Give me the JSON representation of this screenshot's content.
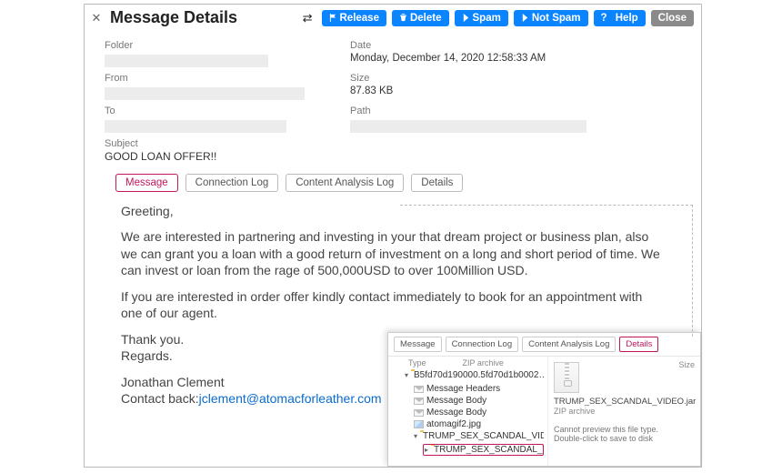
{
  "titlebar": {
    "title": "Message Details",
    "buttons": {
      "release": "Release",
      "delete": "Delete",
      "spam": "Spam",
      "not_spam": "Not Spam",
      "help": "Help",
      "close": "Close"
    }
  },
  "fields": {
    "folder_label": "Folder",
    "from_label": "From",
    "to_label": "To",
    "date_label": "Date",
    "date_value": "Monday, December 14, 2020 12:58:33 AM",
    "size_label": "Size",
    "size_value": "87.83 KB",
    "path_label": "Path",
    "subject_label": "Subject",
    "subject_value": "GOOD LOAN OFFER!!"
  },
  "tabs": {
    "message": "Message",
    "connlog": "Connection Log",
    "calog": "Content Analysis Log",
    "details": "Details"
  },
  "body": {
    "p1": "Greeting,",
    "p2": "We are interested in partnering and investing in your that dream project or business plan, also we can grant you a loan with a good return of investment on a long and short period of time. We can invest or loan from the rage of 500,000USD to over 100Million USD.",
    "p3": "If you are interested in order offer kindly contact immediately to book for an appointment with one of our agent.",
    "p4": "Thank you.",
    "p5": "Regards.",
    "p6": "Jonathan Clement",
    "p7a": "Contact back:",
    "p7b": "jclement@atomacforleather.com"
  },
  "inset": {
    "tabs": {
      "message": "Message",
      "connlog": "Connection Log",
      "calog": "Content Analysis Log",
      "details": "Details"
    },
    "tree_header_type": "Type",
    "tree_header_col2": "ZIP archive",
    "tree_header_col3": "Size",
    "items": {
      "root": "B5fd70d190000.5fd70d1b0002…",
      "mh": "Message Headers",
      "mb1": "Message Body",
      "mb2": "Message Body",
      "img": "atomagif2.jpg",
      "zipfolder": "TRUMP_SEX_SCANDAL_VIDE…",
      "selected": "TRUMP_SEX_SCANDAL_VI…"
    },
    "preview": {
      "filename": "TRUMP_SEX_SCANDAL_VIDEO.jar",
      "filetype": "ZIP archive",
      "line1": "Cannot preview this file type.",
      "line2": "Double-click to save to disk"
    }
  }
}
